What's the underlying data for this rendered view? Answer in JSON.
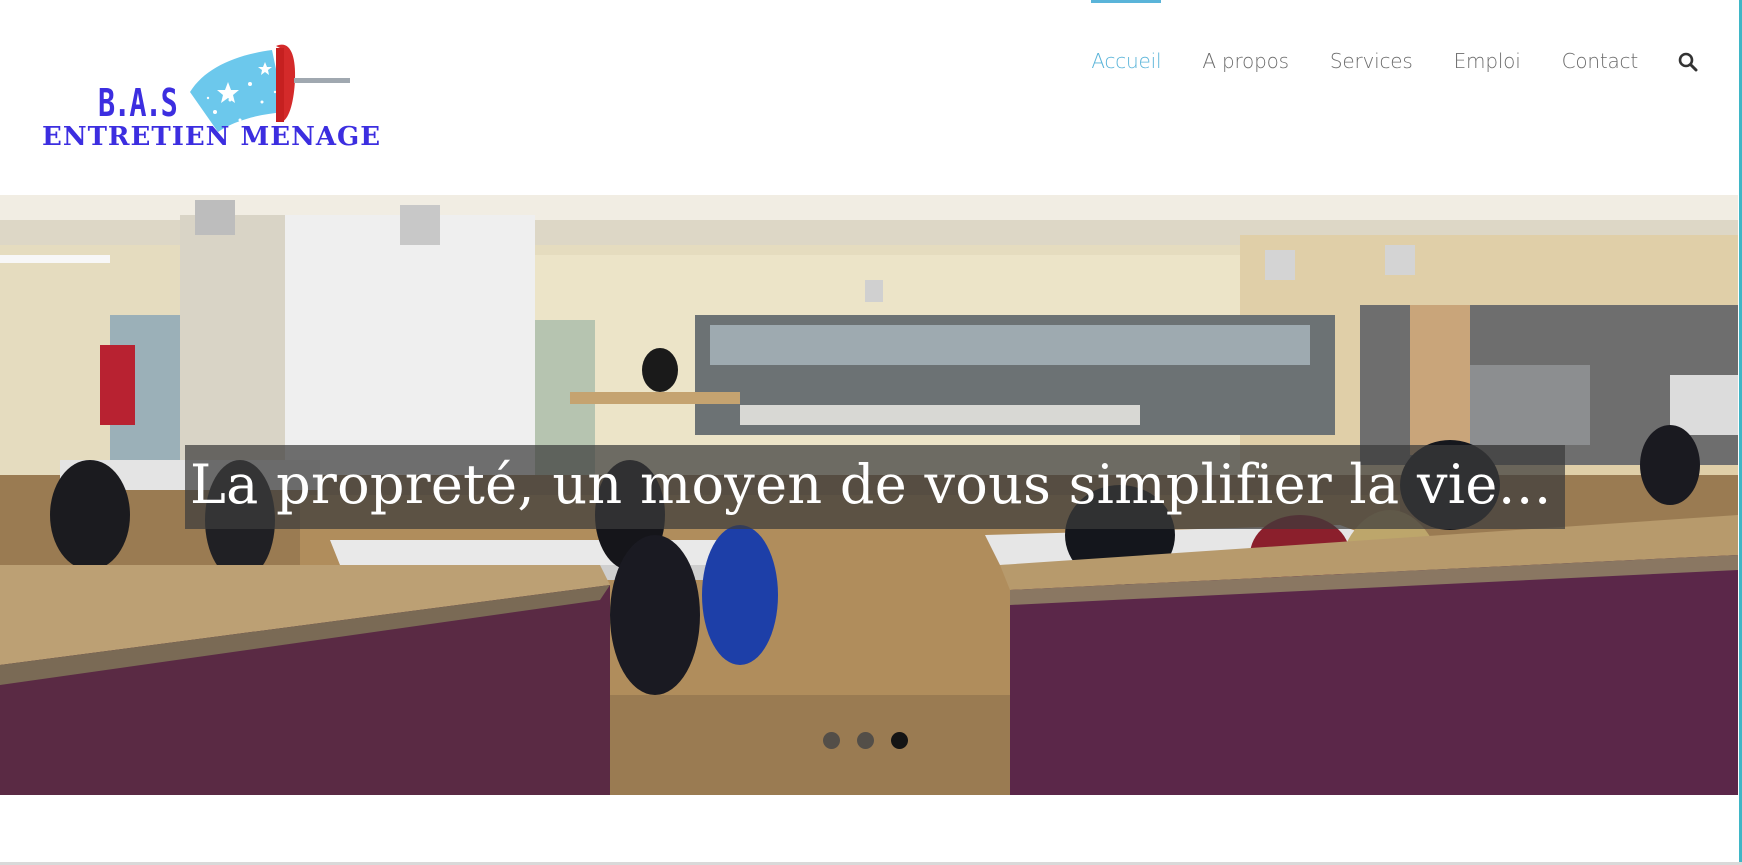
{
  "logo": {
    "line1": "B.A.S",
    "line2": "ENTRETIEN MENAGE"
  },
  "nav": {
    "items": [
      {
        "label": "Accueil"
      },
      {
        "label": "A propos"
      },
      {
        "label": "Services"
      },
      {
        "label": "Emploi"
      },
      {
        "label": "Contact"
      }
    ],
    "search_icon": "search-icon"
  },
  "slider": {
    "caption": "La propreté, un moyen de vous simplifier la vie…",
    "slide_count": 3,
    "active_slide": 3
  },
  "colors": {
    "accent": "#5ab4d9",
    "nav_text": "#6c6c6c",
    "logo_blue": "#3c2ee0",
    "logo_red": "#d42a2a",
    "logo_light_blue": "#6cc8ec"
  }
}
